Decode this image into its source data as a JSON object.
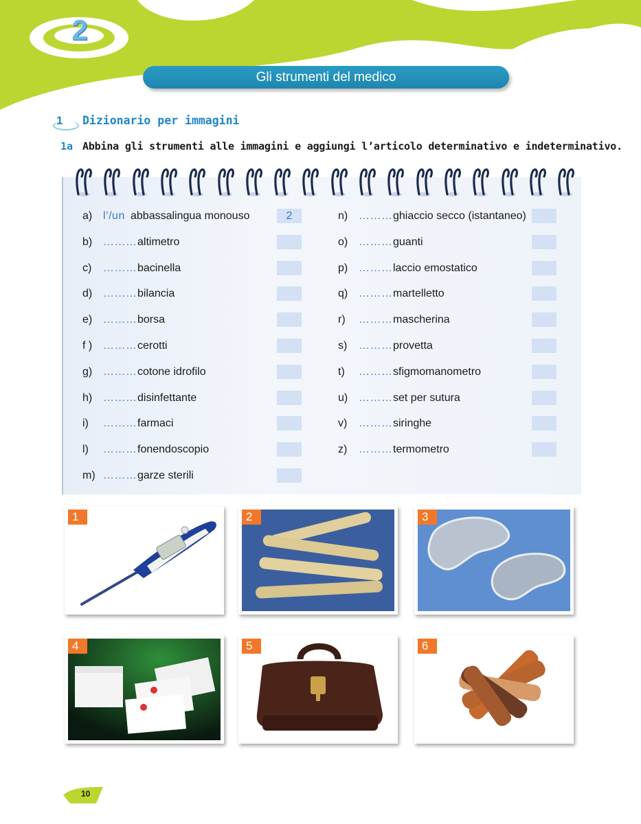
{
  "chapter": {
    "number": "2"
  },
  "title": "Gli strumenti del medico",
  "section": {
    "number": "1",
    "title": "Dizionario per immagini"
  },
  "exercise": {
    "number": "1a",
    "instruction": "Abbina gli strumenti alle immagini e aggiungi l’articolo determinativo e indeterminativo."
  },
  "left_items": [
    {
      "letter": "a)",
      "article": "l’/un",
      "word": "abbassalingua monouso",
      "answer": "2"
    },
    {
      "letter": "b)",
      "article": "………",
      "word": "altimetro",
      "answer": ""
    },
    {
      "letter": "c)",
      "article": "………",
      "word": "bacinella",
      "answer": ""
    },
    {
      "letter": "d)",
      "article": "………",
      "word": "bilancia",
      "answer": ""
    },
    {
      "letter": "e)",
      "article": "………",
      "word": "borsa",
      "answer": ""
    },
    {
      "letter": "f )",
      "article": "………",
      "word": "cerotti",
      "answer": ""
    },
    {
      "letter": "g)",
      "article": "………",
      "word": "cotone idrofilo",
      "answer": ""
    },
    {
      "letter": "h)",
      "article": "………",
      "word": "disinfettante",
      "answer": ""
    },
    {
      "letter": "i)",
      "article": "………",
      "word": "farmaci",
      "answer": ""
    },
    {
      "letter": "l)",
      "article": "………",
      "word": "fonendoscopio",
      "answer": ""
    },
    {
      "letter": "m)",
      "article": "………",
      "word": "garze sterili",
      "answer": ""
    }
  ],
  "right_items": [
    {
      "letter": "n)",
      "article": "………",
      "word": "ghiaccio secco (istantaneo)",
      "answer": ""
    },
    {
      "letter": "o)",
      "article": "………",
      "word": "guanti",
      "answer": ""
    },
    {
      "letter": "p)",
      "article": "………",
      "word": "laccio emostatico",
      "answer": ""
    },
    {
      "letter": "q)",
      "article": "………",
      "word": "martelletto",
      "answer": ""
    },
    {
      "letter": "r)",
      "article": "………",
      "word": "mascherina",
      "answer": ""
    },
    {
      "letter": "s)",
      "article": "………",
      "word": "provetta",
      "answer": ""
    },
    {
      "letter": "t)",
      "article": "………",
      "word": "sfigmomanometro",
      "answer": ""
    },
    {
      "letter": "u)",
      "article": "………",
      "word": "set per sutura",
      "answer": ""
    },
    {
      "letter": "v)",
      "article": "………",
      "word": "siringhe",
      "answer": ""
    },
    {
      "letter": "z)",
      "article": "………",
      "word": "termometro",
      "answer": ""
    }
  ],
  "photos": [
    {
      "badge": "1",
      "subject": "thermometer-image"
    },
    {
      "badge": "2",
      "subject": "tongue-depressors-image"
    },
    {
      "badge": "3",
      "subject": "kidney-dishes-image"
    },
    {
      "badge": "4",
      "subject": "sterile-gauze-image"
    },
    {
      "badge": "5",
      "subject": "doctor-bag-image"
    },
    {
      "badge": "6",
      "subject": "plasters-image"
    }
  ],
  "page_number": "10",
  "colors": {
    "accent_green": "#bcd631",
    "title_blue": "#1f86ad",
    "heading_blue": "#1f86c8",
    "badge_orange": "#f1782a",
    "answer_box": "#d4e1f4"
  }
}
